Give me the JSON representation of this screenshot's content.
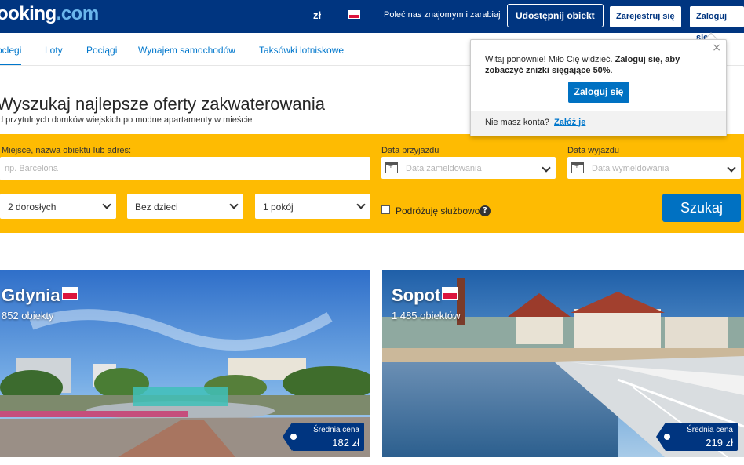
{
  "header": {
    "logo_main": "ooking",
    "logo_dot": ".com",
    "currency": "zł",
    "language_flag": "poland-flag-icon",
    "refer": "Poleć nas znajomym i zarabiaj",
    "list_property": "Udostępnij obiekt",
    "register": "Zarejestruj się",
    "login": "Zaloguj się"
  },
  "nav": {
    "tabs": [
      {
        "label": "oclegi",
        "active": true
      },
      {
        "label": "Loty"
      },
      {
        "label": "Pociągi"
      },
      {
        "label": "Wynajem samochodów"
      },
      {
        "label": "Taksówki lotniskowe"
      }
    ]
  },
  "hero": {
    "title": "Wyszukaj najlepsze oferty zakwaterowania",
    "subtitle": "d przytulnych domków wiejskich po modne apartamenty w mieście"
  },
  "search": {
    "destination_label": "Miejsce, nazwa obiektu lub adres:",
    "destination_placeholder": "np. Barcelona",
    "checkin_label": "Data przyjazdu",
    "checkin_placeholder": "Data zameldowania",
    "checkout_label": "Data wyjazdu",
    "checkout_placeholder": "Data wymeldowania",
    "adults": "2 dorosłych",
    "children": "Bez dzieci",
    "rooms": "1 pokój",
    "business_trip": "Podróżuję służbowo",
    "help_symbol": "?",
    "submit": "Szukaj"
  },
  "popover": {
    "close_symbol": "×",
    "greeting": "Witaj ponownie! Miło Cię widzieć.",
    "prompt_bold": "Zaloguj się, aby zobaczyć zniżki sięgające 50%",
    "prompt_end": ".",
    "button": "Zaloguj się",
    "no_account": "Nie masz konta?",
    "create_link": "Załóż je"
  },
  "destinations": [
    {
      "city": "Gdynia",
      "properties": "852 obiekty",
      "price_label": "Średnia cena",
      "price": "182 zł"
    },
    {
      "city": "Sopot",
      "properties": "1 485 obiektów",
      "price_label": "Średnia cena",
      "price": "219 zł"
    }
  ],
  "colors": {
    "brand_blue": "#003580",
    "search_yellow": "#febb02",
    "action_blue": "#0071c2",
    "link_blue": "#0077cc"
  }
}
